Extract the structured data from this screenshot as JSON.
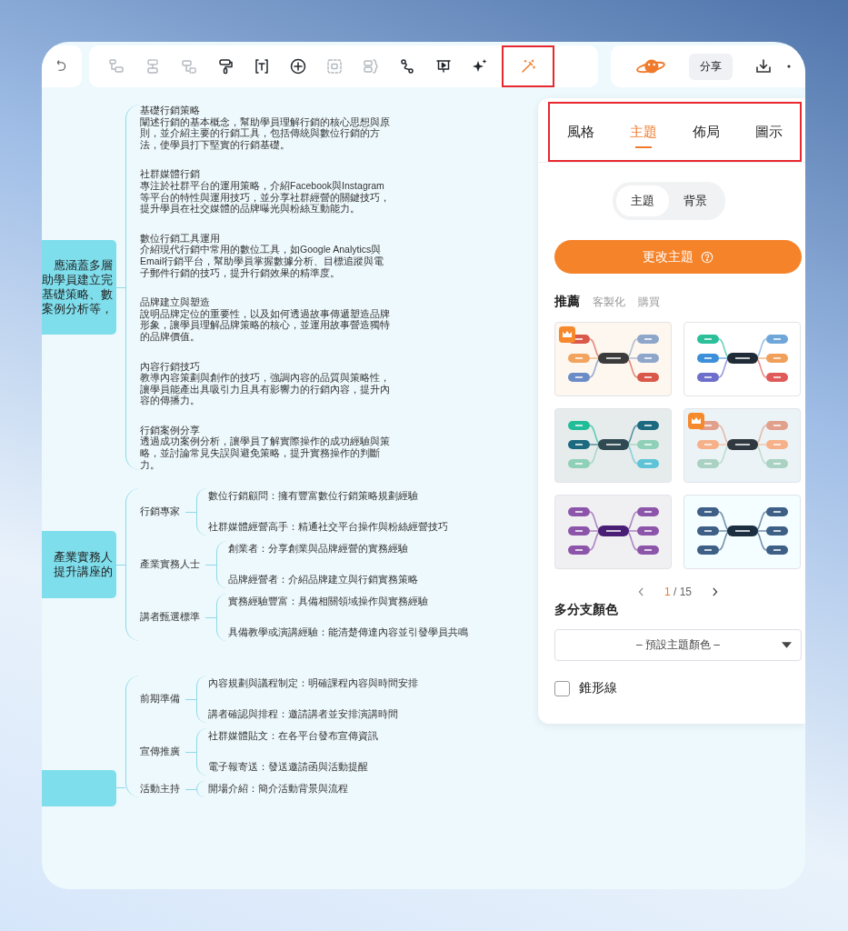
{
  "toolbar": {
    "tools": [
      {
        "disabled": true,
        "highlighted": false
      },
      {
        "disabled": true,
        "highlighted": false
      },
      {
        "disabled": true,
        "highlighted": false
      },
      {
        "disabled": false,
        "highlighted": false
      },
      {
        "disabled": false,
        "highlighted": false
      },
      {
        "disabled": false,
        "highlighted": false
      },
      {
        "disabled": true,
        "highlighted": false
      },
      {
        "disabled": true,
        "highlighted": false
      },
      {
        "disabled": false,
        "highlighted": false
      },
      {
        "disabled": false,
        "highlighted": false
      },
      {
        "disabled": false,
        "highlighted": false
      },
      {
        "disabled": false,
        "highlighted": true
      }
    ]
  },
  "header": {
    "share": "分享"
  },
  "mindmap": {
    "groups": [
      {
        "kind": "detail",
        "root_lines": [
          "應涵蓋多層",
          "助學員建立完",
          "基礎策略、數",
          "案例分析等，"
        ],
        "children": [
          {
            "title": "基礎行銷策略",
            "text": "闡述行銷的基本概念，幫助學員理解行銷的核心思想與原則，並介紹主要的行銷工具，包括傳統與數位行銷的方法，使學員打下堅實的行銷基礎。"
          },
          {
            "title": "社群媒體行銷",
            "text": "專注於社群平台的運用策略，介紹Facebook與Instagram等平台的特性與運用技巧，並分享社群經營的關鍵技巧，提升學員在社交媒體的品牌曝光與粉絲互動能力。"
          },
          {
            "title": "數位行銷工具運用",
            "text": "介紹現代行銷中常用的數位工具，如Google Analytics與Email行銷平台，幫助學員掌握數據分析、目標追蹤與電子郵件行銷的技巧，提升行銷效果的精準度。"
          },
          {
            "title": "品牌建立與塑造",
            "text": "說明品牌定位的重要性，以及如何透過故事傳遞塑造品牌形象，讓學員理解品牌策略的核心，並運用故事營造獨特的品牌價值。"
          },
          {
            "title": "內容行銷技巧",
            "text": "教導內容策劃與創作的技巧，強調內容的品質與策略性，讓學員能產出具吸引力且具有影響力的行銷內容，提升內容的傳播力。"
          },
          {
            "title": "行銷案例分享",
            "text": "透過成功案例分析，讓學員了解實際操作的成功經驗與策略，並討論常見失誤與避免策略，提升實務操作的判斷力。"
          }
        ]
      },
      {
        "kind": "branch",
        "root_lines": [
          "產業實務人",
          "提升講座的"
        ],
        "children": [
          {
            "label": "行銷專家",
            "children": [
              {
                "text": "數位行銷顧問：擁有豐富數位行銷策略規劃經驗"
              },
              {
                "text": "社群媒體經營高手：精通社交平台操作與粉絲經營技巧"
              }
            ]
          },
          {
            "label": "產業實務人士",
            "children": [
              {
                "text": "創業者：分享創業與品牌經營的實務經驗"
              },
              {
                "text": "品牌經營者：介紹品牌建立與行銷實務策略"
              }
            ]
          },
          {
            "label": "講者甄選標準",
            "children": [
              {
                "text": "實務經驗豐富：具備相關領域操作與實務經驗"
              },
              {
                "text": "具備教學或演講經驗：能清楚傳達內容並引發學員共鳴"
              }
            ]
          }
        ]
      },
      {
        "kind": "branch",
        "children": [
          {
            "label": "前期準備",
            "children": [
              {
                "text": "內容規劃與議程制定：明確課程內容與時間安排"
              },
              {
                "text": "講者確認與排程：邀請講者並安排演講時間"
              }
            ]
          },
          {
            "label": "宣傳推廣",
            "children": [
              {
                "text": "社群媒體貼文：在各平台發布宣傳資訊"
              },
              {
                "text": "電子報寄送：發送邀請函與活動提醒"
              }
            ]
          },
          {
            "label": "活動主持",
            "children": [
              {
                "text": "開場介紹：簡介活動背景與流程"
              }
            ]
          }
        ]
      }
    ]
  },
  "panel": {
    "highlighted": true,
    "tabs": [
      {
        "label": "風格",
        "selected": false
      },
      {
        "label": "主題",
        "selected": true
      },
      {
        "label": "佈局",
        "selected": false
      },
      {
        "label": "圖示",
        "selected": false
      }
    ],
    "toggle": [
      {
        "label": "主題",
        "selected": true
      },
      {
        "label": "背景",
        "selected": false
      }
    ],
    "action": "更改主題",
    "subtabs": [
      {
        "label": "推薦",
        "selected": true
      },
      {
        "label": "客製化",
        "selected": false
      },
      {
        "label": "購買",
        "selected": false
      }
    ],
    "themes": [
      {
        "premium": true
      },
      {
        "premium": false
      },
      {
        "premium": false
      },
      {
        "premium": true
      },
      {
        "premium": false
      },
      {
        "premium": false
      }
    ],
    "pager": {
      "current": "1",
      "separator": "/",
      "total": "15"
    },
    "branch_color": {
      "title": "多分支顏色",
      "value": "– 預設主題顏色 –"
    },
    "tapered": {
      "label": "錐形線",
      "checked": false
    }
  }
}
